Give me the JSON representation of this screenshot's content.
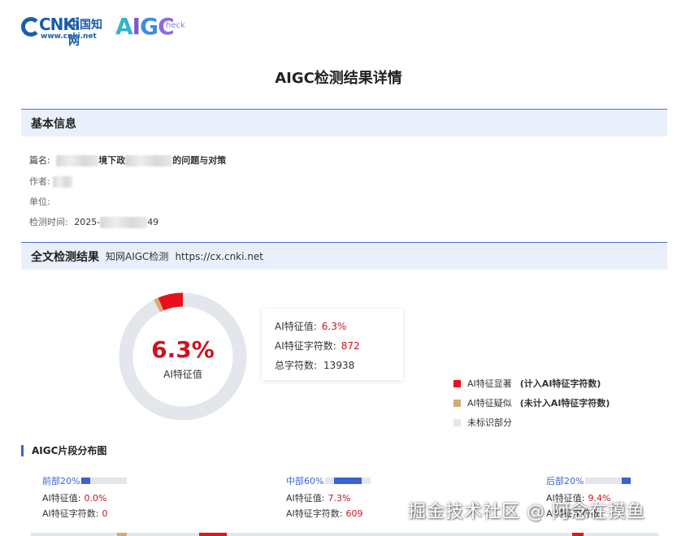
{
  "logos": {
    "cnki_word": "CNKi",
    "cnki_cn": "中国知网",
    "cnki_url": "www.cnki.net",
    "aigc": "AIGC",
    "aigc_small": "heck"
  },
  "page_title": "AIGC检测结果详情",
  "basic": {
    "heading": "基本信息",
    "title_label": "篇名:",
    "title_part1": "境下政",
    "title_part2": "的问题与对策",
    "author_label": "作者:",
    "unit_label": "单位:",
    "time_label": "检测时间:",
    "time_prefix": "2025-",
    "time_suffix": "49"
  },
  "result": {
    "heading": "全文检测结果",
    "service": "知网AIGC检测",
    "url": "https://cx.cnki.net",
    "percent_text": "6.3%",
    "percent_label": "AI特征值",
    "ai_value_label": "AI特征值:",
    "ai_value": "6.3%",
    "ai_chars_label": "AI特征字符数:",
    "ai_chars": "872",
    "total_chars_label": "总字符数:",
    "total_chars": "13938",
    "donut": {
      "significant": 0.063,
      "suspected": 0.012
    }
  },
  "legend": [
    {
      "label": "AI特征显著",
      "note": "(计入AI特征字符数)",
      "color": "#e8101b"
    },
    {
      "label": "AI特征疑似",
      "note": "(未计入AI特征字符数)",
      "color": "#d2ab7b"
    },
    {
      "label": "未标识部分",
      "note": "",
      "color": "#e3e6ea"
    }
  ],
  "distribution": {
    "heading": "AIGC片段分布图",
    "segments": [
      {
        "name": "前部20%",
        "ai_label": "AI特征值:",
        "ai_value": "0.0%",
        "chars_label": "AI特征字符数:",
        "chars": "0",
        "bar_fill": 0.2
      },
      {
        "name": "中部60%",
        "ai_label": "AI特征值:",
        "ai_value": "7.3%",
        "chars_label": "AI特征字符数:",
        "chars": "609",
        "bar_fill": 0.6
      },
      {
        "name": "后部20%",
        "ai_label": "AI特征值:",
        "ai_value": "9.4%",
        "chars_label": "AI特征字符数:",
        "chars": "",
        "bar_fill": 0.2
      }
    ]
  },
  "watermark": "掘金技术社区 @ 阿念在摸鱼",
  "colors": {
    "accent": "#3a62d0",
    "red": "#d0111b",
    "track": "#e3e6ea",
    "section_bg": "#eaf0fb"
  }
}
